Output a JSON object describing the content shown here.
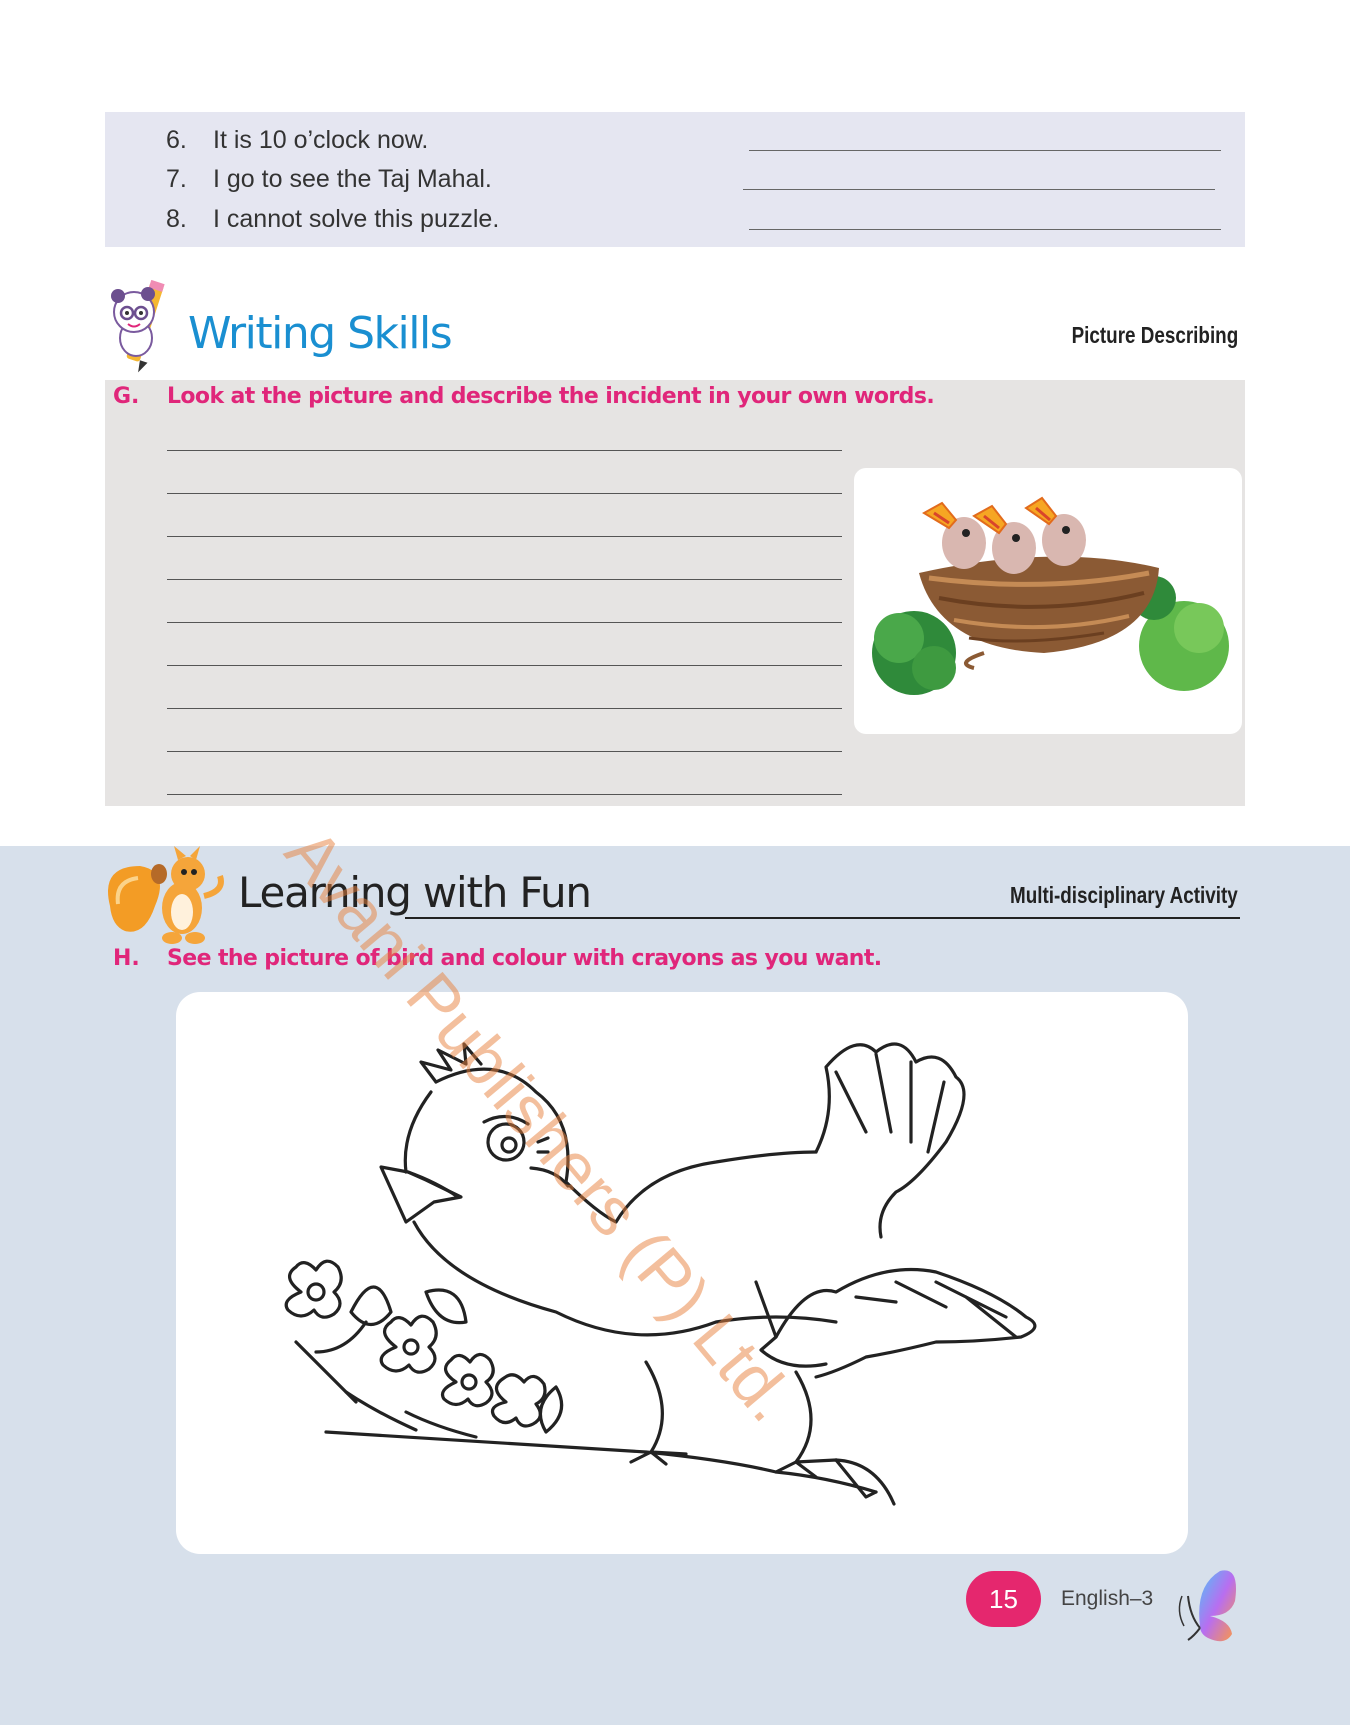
{
  "top_exercise": {
    "sentences": [
      {
        "num": "6.",
        "text": "It is 10 o’clock now."
      },
      {
        "num": "7.",
        "text": "I go to see the Taj Mahal."
      },
      {
        "num": "8.",
        "text": "I cannot solve this puzzle."
      }
    ]
  },
  "writing_section": {
    "title": "Writing Skills",
    "tag": "Picture Describing",
    "question_label": "G.",
    "question_text": "Look at the picture and describe the incident in your own words.",
    "picture": "bird-nest-with-chicks"
  },
  "fun_section": {
    "title": "Learning with Fun",
    "tag": "Multi-disciplinary Activity",
    "question_label": "H.",
    "question_text": "See the picture of bird and colour with crayons as you want.",
    "picture": "bird-outline-colouring"
  },
  "footer": {
    "page_number": "15",
    "book": "English–3"
  },
  "watermark": "Avani Publishers (P) Ltd.",
  "colors": {
    "accent_pink": "#e0267a",
    "title_blue": "#1a8fd1",
    "top_box_bg": "#e5e6f1",
    "write_box_bg": "#e6e4e3",
    "bottom_bg": "#d7e0eb"
  }
}
